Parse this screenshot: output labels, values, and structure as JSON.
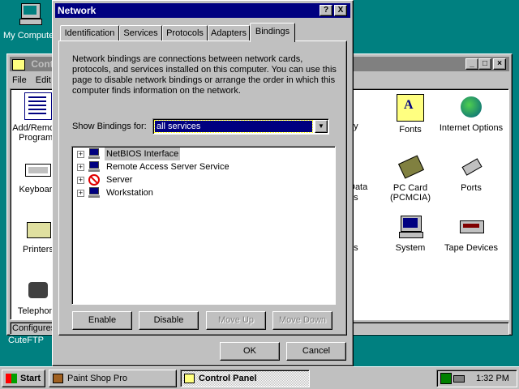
{
  "desktop": {
    "my_computer_label": "My Computer",
    "cuteftp_label": "CuteFTP"
  },
  "control_panel": {
    "title": "Control Panel",
    "menu": [
      "File",
      "Edit"
    ],
    "status_text": "Configures",
    "items_left": [
      "Add/Remove Programs",
      "Keyboard",
      "Printers",
      "Telephony"
    ],
    "items": [
      {
        "label": "Fonts",
        "icon": "fonts-icon"
      },
      {
        "label": "Internet Options",
        "icon": "internet-options-icon"
      },
      {
        "label": "PC Card (PCMCIA)",
        "icon": "pc-card-icon"
      },
      {
        "label": "Ports",
        "icon": "ports-icon"
      },
      {
        "label": "System",
        "icon": "system-icon"
      },
      {
        "label": "Tape Devices",
        "icon": "tape-devices-icon"
      }
    ],
    "partial_labels": [
      "ay",
      "Data",
      "es",
      "ds"
    ]
  },
  "network_dialog": {
    "title": "Network",
    "help_btn": "?",
    "close_btn": "X",
    "tabs": [
      "Identification",
      "Services",
      "Protocols",
      "Adapters",
      "Bindings"
    ],
    "active_tab": "Bindings",
    "description": "Network bindings are connections between network cards, protocols, and services installed on this computer.  You can use this page to disable network bindings or arrange the order in which this computer finds information on the network.",
    "show_bindings_label": "Show Bindings for:",
    "show_bindings_value": "all services",
    "tree_items": [
      {
        "label": "NetBIOS Interface",
        "icon": "network-component-icon",
        "selected": true
      },
      {
        "label": "Remote Access Server Service",
        "icon": "network-component-icon"
      },
      {
        "label": "Server",
        "icon": "disabled-icon"
      },
      {
        "label": "Workstation",
        "icon": "network-component-icon"
      }
    ],
    "buttons": {
      "enable": "Enable",
      "disable": "Disable",
      "move_up": "Move Up",
      "move_down": "Move Down",
      "ok": "OK",
      "cancel": "Cancel"
    }
  },
  "taskbar": {
    "start": "Start",
    "tasks": [
      "Paint Shop Pro",
      "Control Panel"
    ],
    "clock": "1:32 PM"
  },
  "colors": {
    "desktop": "#008080",
    "title_active": "#000080",
    "title_inactive": "#808080",
    "face": "#c0c0c0"
  }
}
